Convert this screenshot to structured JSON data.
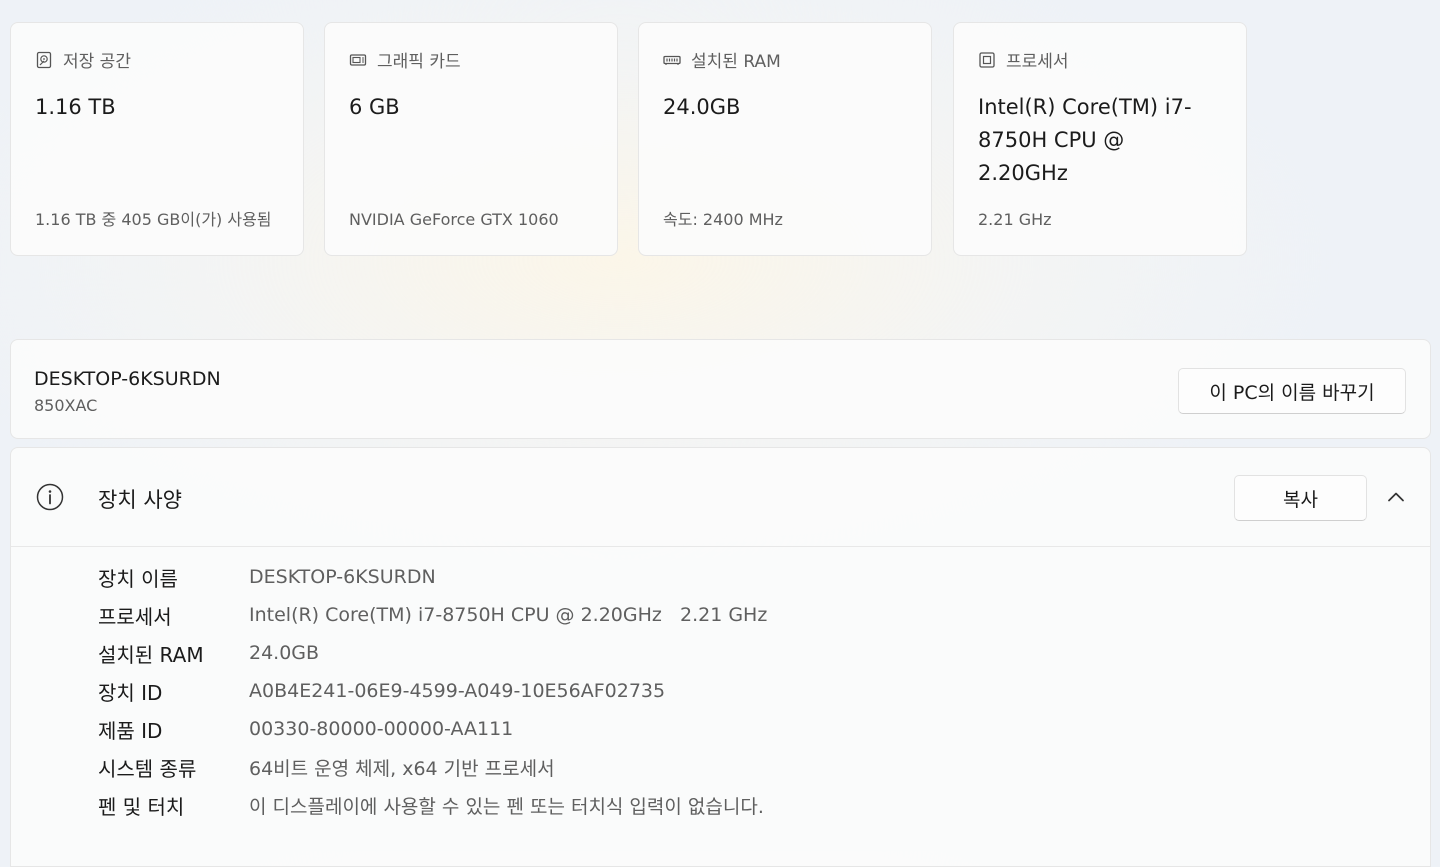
{
  "cards": [
    {
      "icon": "storage-icon",
      "title": "저장 공간",
      "value": "1.16 TB",
      "sub": "1.16 TB 중 405 GB이(가) 사용됨"
    },
    {
      "icon": "graphics-card-icon",
      "title": "그래픽 카드",
      "value": "6 GB",
      "sub": "NVIDIA GeForce GTX 1060"
    },
    {
      "icon": "ram-icon",
      "title": "설치된 RAM",
      "value": "24.0GB",
      "sub": "속도: 2400 MHz"
    },
    {
      "icon": "processor-icon",
      "title": "프로세서",
      "value": "Intel(R) Core(TM) i7-8750H CPU @ 2.20GHz",
      "sub": "2.21 GHz"
    }
  ],
  "pc": {
    "name": "DESKTOP-6KSURDN",
    "model": "850XAC",
    "rename_label": "이 PC의 이름 바꾸기"
  },
  "specs": {
    "title": "장치 사양",
    "copy_label": "복사",
    "rows": [
      {
        "label": "장치 이름",
        "value": "DESKTOP-6KSURDN"
      },
      {
        "label": "프로세서",
        "value": "Intel(R) Core(TM) i7-8750H CPU @ 2.20GHz   2.21 GHz"
      },
      {
        "label": "설치된 RAM",
        "value": "24.0GB"
      },
      {
        "label": "장치 ID",
        "value": "A0B4E241-06E9-4599-A049-10E56AF02735"
      },
      {
        "label": "제품 ID",
        "value": "00330-80000-00000-AA111"
      },
      {
        "label": "시스템 종류",
        "value": "64비트 운영 체제, x64 기반 프로세서"
      },
      {
        "label": "펜 및 터치",
        "value": "이 디스플레이에 사용할 수 있는 펜 또는 터치식 입력이 없습니다."
      }
    ]
  }
}
